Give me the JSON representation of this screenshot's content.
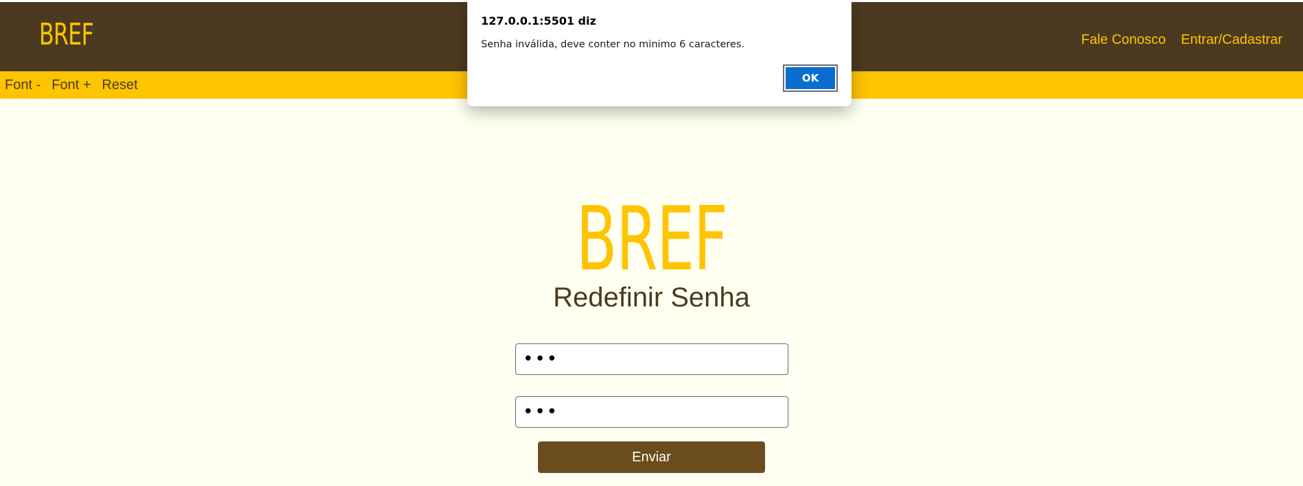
{
  "header": {
    "logo": "BREF",
    "nav": [
      "Fale Conosco",
      "Entrar/Cadastrar"
    ]
  },
  "accessibility_bar": {
    "buttons": [
      "Font -",
      "Font +",
      "Reset"
    ]
  },
  "main": {
    "logo": "BREF",
    "title": "Redefinir Senha",
    "password_value": "•••",
    "confirm_password_value": "•••",
    "submit_label": "Enviar"
  },
  "alert": {
    "title": "127.0.0.1:5501 diz",
    "message": "Senha inválida, deve conter no minimo 6 caracteres.",
    "ok_label": "OK"
  },
  "colors": {
    "header_bg": "#4b3a1f",
    "accent": "#ffc400",
    "page_bg": "#fffff2",
    "button_bg": "#6b4c1c",
    "alert_ok": "#0a6ed1"
  }
}
